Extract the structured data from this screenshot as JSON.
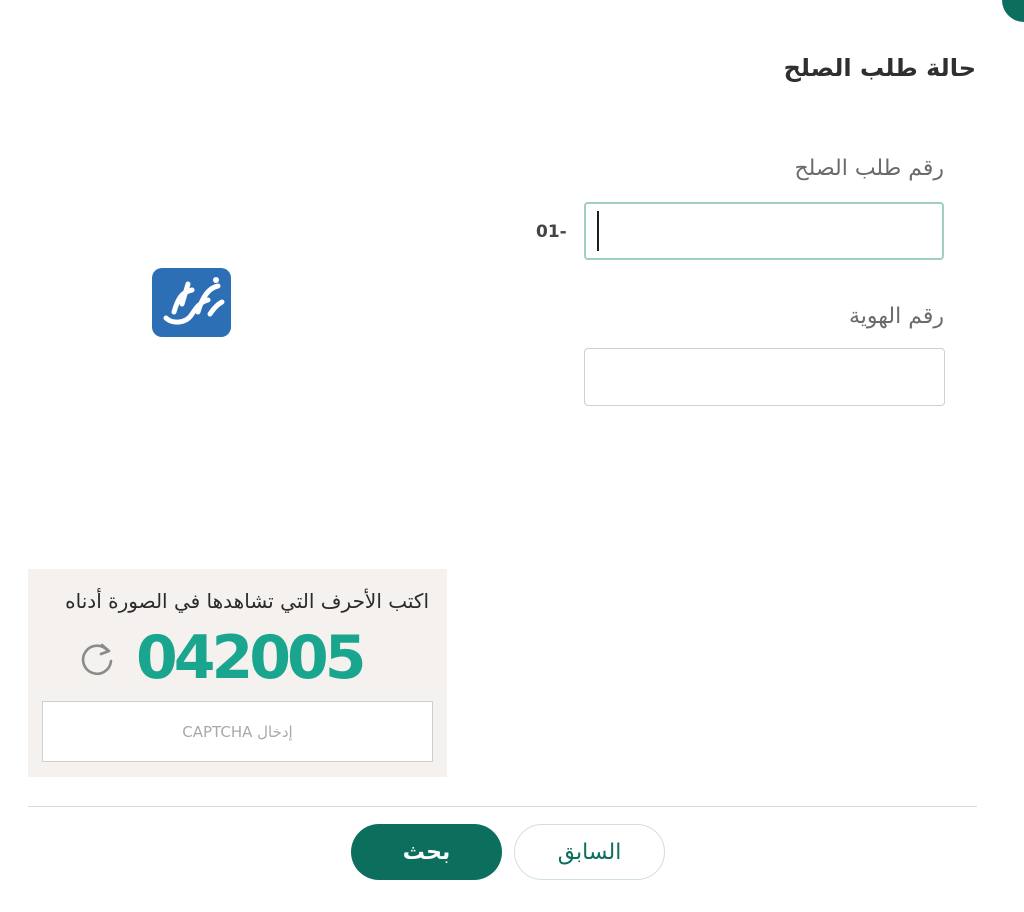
{
  "page": {
    "title": "حالة طلب الصلح"
  },
  "form": {
    "request_number_label": "رقم طلب الصلح",
    "request_number_prefix": "01-",
    "request_number_value": "",
    "id_number_label": "رقم الهوية",
    "id_number_value": ""
  },
  "captcha": {
    "instruction": "اكتب الأحرف التي تشاهدها في الصورة أدناه",
    "code": "042005",
    "input_placeholder": "إدخال CAPTCHA",
    "refresh_icon": "refresh-icon"
  },
  "buttons": {
    "search_label": "بحث",
    "previous_label": "السابق"
  },
  "colors": {
    "primary": "#0c6e5c",
    "captcha_text": "#1aa58f",
    "logo_background": "#2d6fb5"
  }
}
